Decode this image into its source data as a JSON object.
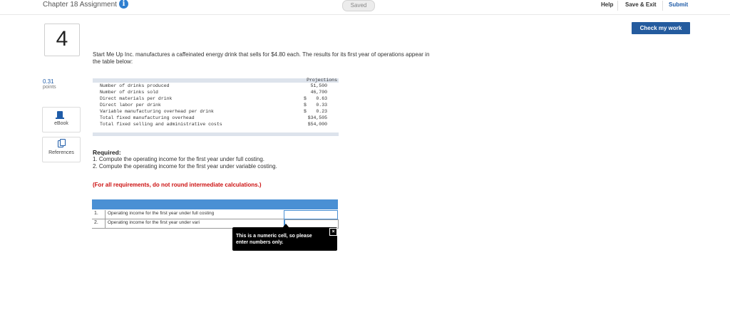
{
  "header": {
    "assignment_title": "Chapter 18 Assignment",
    "info_icon": "i",
    "saved_status": "Saved",
    "help_label": "Help",
    "save_exit_label": "Save & Exit",
    "submit_label": "Submit",
    "check_work_label": "Check my work"
  },
  "sidebar": {
    "question_number": "4",
    "points_value": "0.31",
    "points_label": "points",
    "ebook_label": "eBook",
    "references_label": "References"
  },
  "question": {
    "intro_line1": "Start Me Up Inc. manufactures a caffeinated energy drink that sells for $4.80 each. The results for its first year of operations appear in",
    "intro_line2": "the table below:",
    "table_header": "Projections",
    "rows": [
      {
        "label": "Number of drinks produced",
        "dollar": "",
        "value": "51,500"
      },
      {
        "label": "Number of drinks sold",
        "dollar": "",
        "value": "46,700"
      },
      {
        "label": "Direct materials per drink",
        "dollar": "$",
        "value": "0.63"
      },
      {
        "label": "Direct labor per drink",
        "dollar": "$",
        "value": "0.33"
      },
      {
        "label": "Variable manufacturing overhead per drink",
        "dollar": "$",
        "value": "0.23"
      },
      {
        "label": "Total fixed manufacturing overhead",
        "dollar": "",
        "value": "$34,505"
      },
      {
        "label": "Total fixed selling and administrative costs",
        "dollar": "",
        "value": "$54,000"
      }
    ],
    "required_heading": "Required:",
    "requirement_1": "1. Compute the operating income for the first year under full costing.",
    "requirement_2": "2. Compute the operating income for the first year under variable costing.",
    "rounding_note": "(For all requirements, do not round intermediate calculations.)"
  },
  "answer_table": {
    "rows": [
      {
        "num": "1.",
        "label": "Operating income for the first year under full costing",
        "value": ""
      },
      {
        "num": "2.",
        "label": "Operating income for the first year under vari",
        "value": ""
      }
    ]
  },
  "tooltip": {
    "text_line1": "This is a numeric cell, so please",
    "text_line2": "enter numbers only.",
    "close_icon": "×"
  },
  "colors": {
    "accent": "#245b9e",
    "table_header": "#4a90d4",
    "warning_text": "#cc1010"
  }
}
